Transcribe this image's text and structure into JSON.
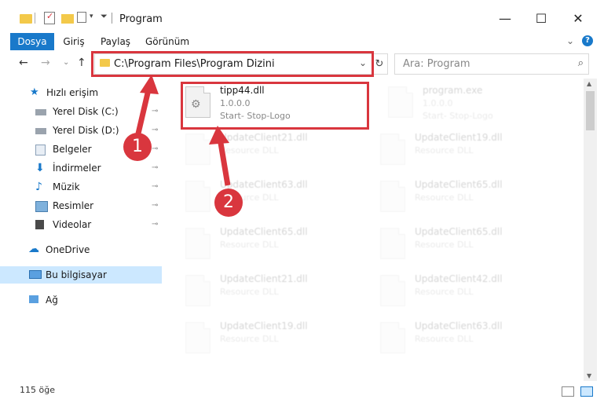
{
  "window": {
    "title": "Program",
    "minimize": "—",
    "maximize": "☐",
    "close": "✕"
  },
  "ribbon": {
    "tabs": [
      "Dosya",
      "Giriş",
      "Paylaş",
      "Görünüm"
    ],
    "expand": "⌄",
    "help": "?"
  },
  "nav": {
    "back": "←",
    "forward": "→",
    "recent": "⌄",
    "up": "↑",
    "address": "C:\\Program Files\\Program Dizini",
    "address_chevron": "⌄",
    "refresh": "↻",
    "search_placeholder": "Ara: Program",
    "search_icon": "⌕"
  },
  "sidebar": {
    "items": [
      {
        "label": "Hızlı erişim",
        "icon": "star-icon",
        "pinned": false
      },
      {
        "label": "Yerel Disk (C:)",
        "icon": "drive-icon",
        "pinned": true
      },
      {
        "label": "Yerel Disk (D:)",
        "icon": "drive-icon",
        "pinned": true
      },
      {
        "label": "Belgeler",
        "icon": "document-icon",
        "pinned": true
      },
      {
        "label": "İndirmeler",
        "icon": "download-icon",
        "pinned": true
      },
      {
        "label": "Müzik",
        "icon": "music-icon",
        "pinned": true
      },
      {
        "label": "Resimler",
        "icon": "pictures-icon",
        "pinned": true
      },
      {
        "label": "Videolar",
        "icon": "video-icon",
        "pinned": true
      },
      {
        "label": "OneDrive",
        "icon": "cloud-icon",
        "pinned": false
      },
      {
        "label": "Bu bilgisayar",
        "icon": "computer-icon",
        "pinned": false
      },
      {
        "label": "Ağ",
        "icon": "network-icon",
        "pinned": false
      }
    ],
    "pin_glyph": "📌"
  },
  "files": [
    {
      "name": "tipp44.dll",
      "line2": "1.0.0.0",
      "line3": "Start- Stop-Logo"
    },
    {
      "name": "program.exe",
      "line2": "1.0.0.0",
      "line3": "Start- Stop-Logo"
    },
    {
      "name": "UpdateClient21.dll",
      "line2": "Resource DLL",
      "line3": ""
    },
    {
      "name": "UpdateClient19.dll",
      "line2": "Resource DLL",
      "line3": ""
    },
    {
      "name": "UpdateClient63.dll",
      "line2": "Resource DLL",
      "line3": ""
    },
    {
      "name": "UpdateClient65.dll",
      "line2": "Resource DLL",
      "line3": ""
    },
    {
      "name": "UpdateClient65.dll",
      "line2": "Resource DLL",
      "line3": ""
    },
    {
      "name": "UpdateClient65.dll",
      "line2": "Resource DLL",
      "line3": ""
    },
    {
      "name": "UpdateClient21.dll",
      "line2": "Resource DLL",
      "line3": ""
    },
    {
      "name": "UpdateClient42.dll",
      "line2": "Resource DLL",
      "line3": ""
    },
    {
      "name": "UpdateClient19.dll",
      "line2": "Resource DLL",
      "line3": ""
    },
    {
      "name": "UpdateClient63.dll",
      "line2": "Resource DLL",
      "line3": ""
    }
  ],
  "status": {
    "count": "115 öğe"
  },
  "annotations": [
    "1",
    "2"
  ],
  "colors": {
    "accent": "#1979ca",
    "highlight": "#d9363e",
    "selected": "#cce8ff"
  }
}
